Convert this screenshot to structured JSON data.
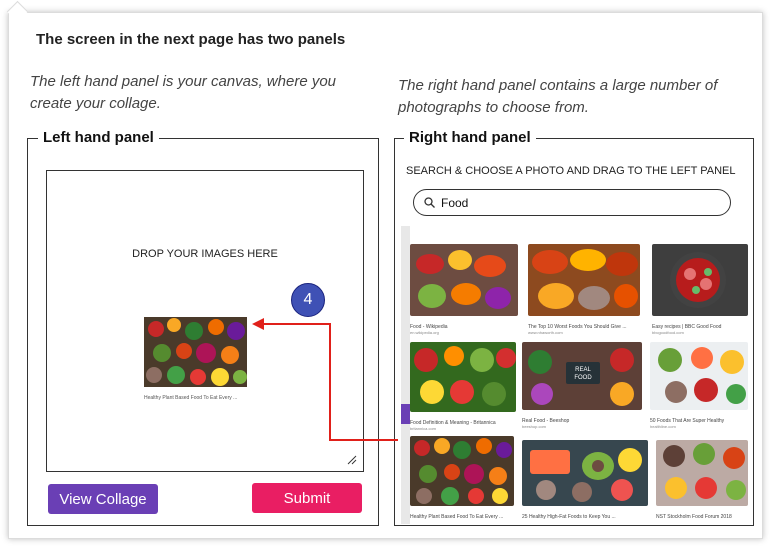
{
  "heading": "The screen in the next page has two panels",
  "left_description": "The left hand panel is your canvas, where you create your collage.",
  "right_description": "The right hand panel contains a large number of photographs to choose from.",
  "left_panel": {
    "title": "Left hand panel",
    "drop_text": "DROP YOUR IMAGES HERE",
    "placed_caption": "Healthy Plant Based Food To Eat Every ...",
    "step_badge": "4",
    "view_button": "View Collage",
    "submit_button": "Submit"
  },
  "right_panel": {
    "title": "Right hand panel",
    "instruction": "SEARCH & CHOOSE A PHOTO AND DRAG TO THE LEFT PANEL",
    "search_value": "Food",
    "photos": [
      {
        "caption": "Food - Wikipedia",
        "source": "en.wikipedia.org"
      },
      {
        "caption": "The Top 10 Worst Foods You Should Give ...",
        "source": "www.nhaworth.com"
      },
      {
        "caption": "Easy recipes | BBC Good Food",
        "source": "bbcgoodfood.com"
      },
      {
        "caption": "Food Definition & Meaning - Britannica",
        "source": "britannica.com"
      },
      {
        "caption": "Real Food - Beeshop",
        "source": "beeshop.com"
      },
      {
        "caption": "50 Foods That Are Super Healthy",
        "source": "healthline.com"
      },
      {
        "caption": "Healthy Plant Based Food To Eat Every ...",
        "source": "healthline.com"
      },
      {
        "caption": "25 Healthy High-Fat Foods to Keep You ...",
        "source": "healthline.com"
      },
      {
        "caption": "NST Stockholm Food Forum 2018",
        "source": "eatforum.org"
      }
    ]
  },
  "colors": {
    "accent_purple": "#6a3fb5",
    "accent_pink": "#e91e63",
    "badge_blue": "#3f51b5",
    "arrow_red": "#e0201a"
  }
}
